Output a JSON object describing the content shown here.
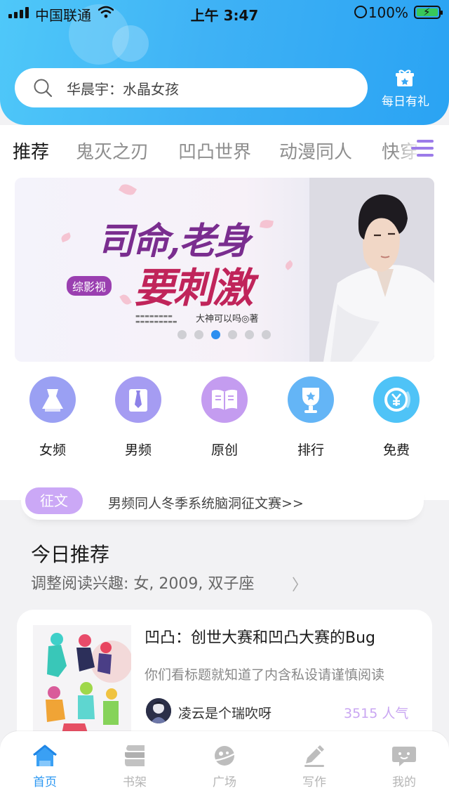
{
  "status_bar": {
    "carrier": "中国联通",
    "time": "上午 3:47",
    "battery": "100%"
  },
  "search": {
    "placeholder": "华晨宇：水晶女孩"
  },
  "daily_gift": {
    "label": "每日有礼"
  },
  "tabs": [
    {
      "label": "推荐",
      "active": true
    },
    {
      "label": "鬼灭之刃",
      "active": false
    },
    {
      "label": "凹凸世界",
      "active": false
    },
    {
      "label": "动漫同人",
      "active": false
    },
    {
      "label": "快穿",
      "active": false
    }
  ],
  "banner": {
    "title_line1": "司命,老身",
    "title_line2": "要刺激",
    "genre_tag": "综影视",
    "author": "大神可以吗◎著",
    "pages": 6,
    "current_page": 3
  },
  "categories": [
    {
      "label": "女频",
      "icon": "dress-icon",
      "color": "#9aa0f3"
    },
    {
      "label": "男频",
      "icon": "shirt-tie-icon",
      "color": "#a59cf2"
    },
    {
      "label": "原创",
      "icon": "open-book-icon",
      "color": "#c49cf0"
    },
    {
      "label": "排行",
      "icon": "trophy-icon",
      "color": "#64b5f6"
    },
    {
      "label": "免费",
      "icon": "yen-coin-icon",
      "color": "#4fc3f7"
    }
  ],
  "contest": {
    "tag": "征文",
    "text": "男频同人冬季系统脑洞征文赛>>"
  },
  "today": {
    "title": "今日推荐",
    "subtitle": "调整阅读兴趣: 女, 2009, 双子座"
  },
  "book": {
    "title": "凹凸：创世大赛和凹凸大赛的Bug",
    "description": "你们看标题就知道了内含私设请谨慎阅读",
    "author": "凌云是个瑞吹呀",
    "popularity": "3515 人气"
  },
  "nav": [
    {
      "label": "首页",
      "icon": "home-icon",
      "active": true
    },
    {
      "label": "书架",
      "icon": "bookshelf-icon",
      "active": false
    },
    {
      "label": "广场",
      "icon": "planet-icon",
      "active": false
    },
    {
      "label": "写作",
      "icon": "pen-icon",
      "active": false
    },
    {
      "label": "我的",
      "icon": "chat-profile-icon",
      "active": false
    }
  ],
  "colors": {
    "header_blue": "#3fb2f5",
    "accent_purple": "#b18bf0",
    "active_nav": "#2d98f2",
    "popularity": "#c9a6f2"
  }
}
